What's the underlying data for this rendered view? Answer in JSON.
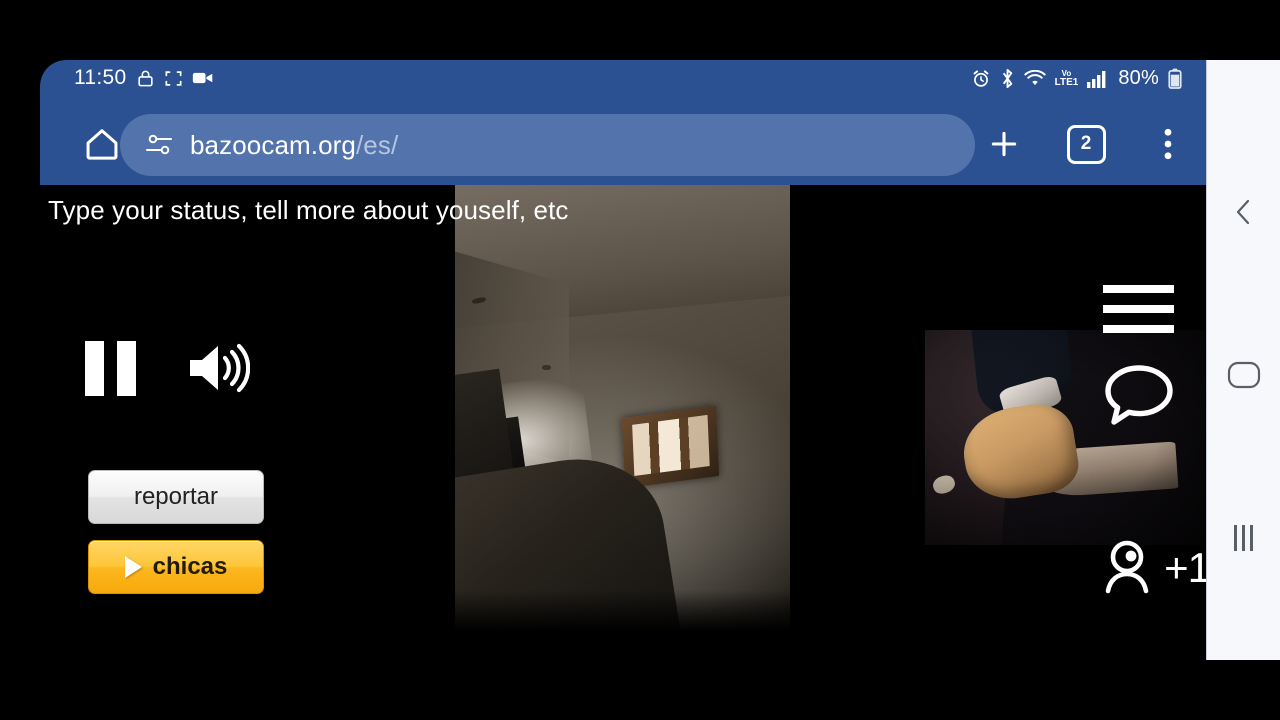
{
  "statusbar": {
    "time": "11:50",
    "left_icons": [
      "lock-icon",
      "screenshot-icon",
      "video-record-icon"
    ],
    "right_icons": [
      "alarm-icon",
      "bluetooth-icon",
      "wifi-icon",
      "volte-icon",
      "signal-bars-icon",
      "battery-icon"
    ],
    "battery_percent": "80%",
    "network_label": "LTE1",
    "network_prefix": "Vo"
  },
  "browser": {
    "home_label": "home-icon",
    "url_domain": "bazoocam.org",
    "url_path": "/es/",
    "new_tab_label": "+",
    "tab_count": "2",
    "menu_label": "menu-icon"
  },
  "page": {
    "status_placeholder": "Type your status, tell more about youself, etc",
    "controls": {
      "pause_label": "pause-icon",
      "volume_label": "volume-icon"
    },
    "buttons": {
      "report": "reportar",
      "girls": "chicas"
    },
    "overlay": {
      "menu_label": "hamburger-icon",
      "chat_label": "chat-bubble-icon",
      "viewers_count": "+1"
    }
  },
  "navbar": {
    "back_label": "back-icon",
    "home_label": "home-pill-icon",
    "recents_label": "recents-icon"
  },
  "colors": {
    "chrome_blue": "#2b5192",
    "urlbar_blue": "#5273ab",
    "accent_orange": "#fbb81f",
    "navbar_bg": "#f7f8fc"
  }
}
